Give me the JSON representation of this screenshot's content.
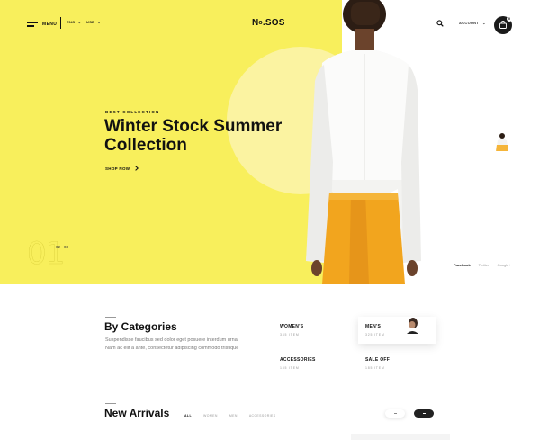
{
  "nav": {
    "menu_label": "MENU",
    "language": "ENG",
    "currency": "USD",
    "logo_main": "N",
    "logo_o": "o",
    "logo_rest": ".SOS",
    "account_label": "ACCOUNT",
    "cart_count": "0"
  },
  "hero": {
    "eyebrow": "BEST COLLECTION",
    "title_line1": "Winter Stock Summer",
    "title_line2": "Collection",
    "cta": "SHOP NOW",
    "slide_current": "01",
    "slide_next": "02",
    "slide_last": "03",
    "bg_color": "#f8ef5c",
    "circle_color": "#fbf3a1"
  },
  "social": [
    "Facebook",
    "Twitter",
    "Google+"
  ],
  "categories": {
    "title": "By Categories",
    "description": "Suspendisse faucibus sed dolor eget posuere interdum urna. Nam ac elit a ante, consectetur adipiscing commodo tristique",
    "items": [
      {
        "name": "WOMEN'S",
        "count": "345 ITEM"
      },
      {
        "name": "MEN'S",
        "count": "325 ITEM"
      },
      {
        "name": "ACCESSORIES",
        "count": "185 ITEM"
      },
      {
        "name": "SALE OFF",
        "count": "185 ITEM"
      }
    ]
  },
  "arrivals": {
    "title": "New Arrivals",
    "tabs": [
      "ALL",
      "WOMEN",
      "MEN",
      "ACCESSORIES"
    ]
  }
}
